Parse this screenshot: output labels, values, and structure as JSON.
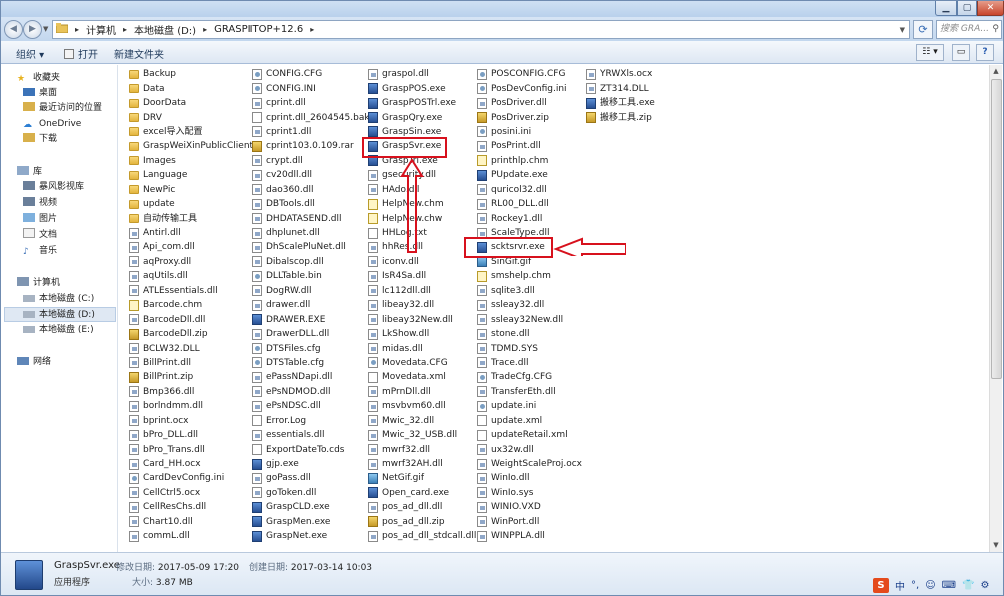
{
  "address": {
    "crumbs": [
      "计算机",
      "本地磁盘 (D:)",
      "GRASPⅡTOP+12.6"
    ],
    "search_placeholder": "搜索 GRA..."
  },
  "toolbar": {
    "organize": "组织 ▾",
    "open": "打开",
    "new_folder": "新建文件夹"
  },
  "sidebar": {
    "favorites": "收藏夹",
    "desktop": "桌面",
    "recent": "最近访问的位置",
    "onedrive": "OneDrive",
    "downloads": "下载",
    "libraries": "库",
    "video_lib": "暴风影视库",
    "videos": "视频",
    "pictures": "图片",
    "documents": "文档",
    "music": "音乐",
    "computer": "计算机",
    "drive_c": "本地磁盘 (C:)",
    "drive_d": "本地磁盘 (D:)",
    "drive_e": "本地磁盘 (E:)",
    "network": "网络"
  },
  "files": {
    "col1": [
      "Backup",
      "Data",
      "DoorData",
      "DRV",
      "excel导入配置",
      "GraspWeiXinPublicClient",
      "Images",
      "Language",
      "NewPic",
      "update",
      "自动传输工具",
      "Antirl.dll",
      "Api_com.dll",
      "aqProxy.dll",
      "aqUtils.dll",
      "ATLEssentials.dll",
      "Barcode.chm",
      "BarcodeDll.dll",
      "BarcodeDll.zip",
      "BCLW32.DLL",
      "BillPrint.dll",
      "BillPrint.zip",
      "Bmp366.dll",
      "borlndmm.dll",
      "bprint.ocx",
      "bPro_DLL.dll",
      "bPro_Trans.dll",
      "Card_HH.ocx",
      "CardDevConfig.ini",
      "CellCtrl5.ocx",
      "CellResChs.dll",
      "Chart10.dll",
      "commL.dll"
    ],
    "col2": [
      "CONFIG.CFG",
      "CONFIG.INI",
      "cprint.dll",
      "cprint.dll_2604545.bak",
      "cprint1.dll",
      "cprint103.0.109.rar",
      "crypt.dll",
      "cv20dll.dll",
      "dao360.dll",
      "DBTools.dll",
      "DHDATASEND.dll",
      "dhplunet.dll",
      "DhScalePluNet.dll",
      "Dibalscop.dll",
      "DLLTable.bin",
      "DogRW.dll",
      "drawer.dll",
      "DRAWER.EXE",
      "DrawerDLL.dll",
      "DTSFiles.cfg",
      "DTSTable.cfg",
      "ePassNDapi.dll",
      "ePsNDMOD.dll",
      "ePsNDSC.dll",
      "Error.Log",
      "essentials.dll",
      "ExportDateTo.cds",
      "gjp.exe",
      "goPass.dll",
      "goToken.dll",
      "GraspCLD.exe",
      "GraspMen.exe",
      "GraspNet.exe"
    ],
    "col3": [
      "graspol.dll",
      "GraspPOS.exe",
      "GraspPOSTrl.exe",
      "GraspQry.exe",
      "GraspSin.exe",
      "GraspSvr.exe",
      "GraspTrl.exe",
      "gsecurity.dll",
      "HAdo.dll",
      "HelpNew.chm",
      "HelpNew.chw",
      "HHLog.txt",
      "hhRes.dll",
      "iconv.dll",
      "IsR4Sa.dll",
      "lc112dll.dll",
      "libeay32.dll",
      "libeay32New.dll",
      "LkShow.dll",
      "midas.dll",
      "Movedata.CFG",
      "Movedata.xml",
      "mPrnDll.dll",
      "msvbvm60.dll",
      "Mwic_32.dll",
      "Mwic_32_USB.dll",
      "mwrf32.dll",
      "mwrf32AH.dll",
      "NetGif.gif",
      "Open_card.exe",
      "pos_ad_dll.dll",
      "pos_ad_dll.zip",
      "pos_ad_dll_stdcall.dll"
    ],
    "col4": [
      "POSCONFIG.CFG",
      "PosDevConfig.ini",
      "PosDriver.dll",
      "PosDriver.zip",
      "posini.ini",
      "PosPrint.dll",
      "printhlp.chm",
      "PUpdate.exe",
      "quricol32.dll",
      "RL00_DLL.dll",
      "Rockey1.dll",
      "ScaleType.dll",
      "scktsrvr.exe",
      "SinGif.gif",
      "smshelp.chm",
      "sqlite3.dll",
      "ssleay32.dll",
      "ssleay32New.dll",
      "stone.dll",
      "TDMD.SYS",
      "Trace.dll",
      "TradeCfg.CFG",
      "TransferEth.dll",
      "update.ini",
      "update.xml",
      "updateRetail.xml",
      "ux32w.dll",
      "WeightScaleProj.ocx",
      "WinIo.dll",
      "WinIo.sys",
      "WINIO.VXD",
      "WinPort.dll",
      "WINPPLA.dll"
    ],
    "col5": [
      "YRWXls.ocx",
      "ZT314.DLL",
      "搬移工具.exe",
      "搬移工具.zip"
    ]
  },
  "details": {
    "name": "GraspSvr.exe",
    "type": "应用程序",
    "modified_label": "修改日期:",
    "modified": "2017-05-09 17:20",
    "created_label": "创建日期:",
    "created": "2017-03-14 10:03",
    "size_label": "大小:",
    "size": "3.87 MB"
  },
  "tray": [
    "中",
    "°,",
    "☺",
    "⌨",
    "👕",
    "⚙"
  ],
  "annotations": {
    "color": "#d7111d"
  }
}
